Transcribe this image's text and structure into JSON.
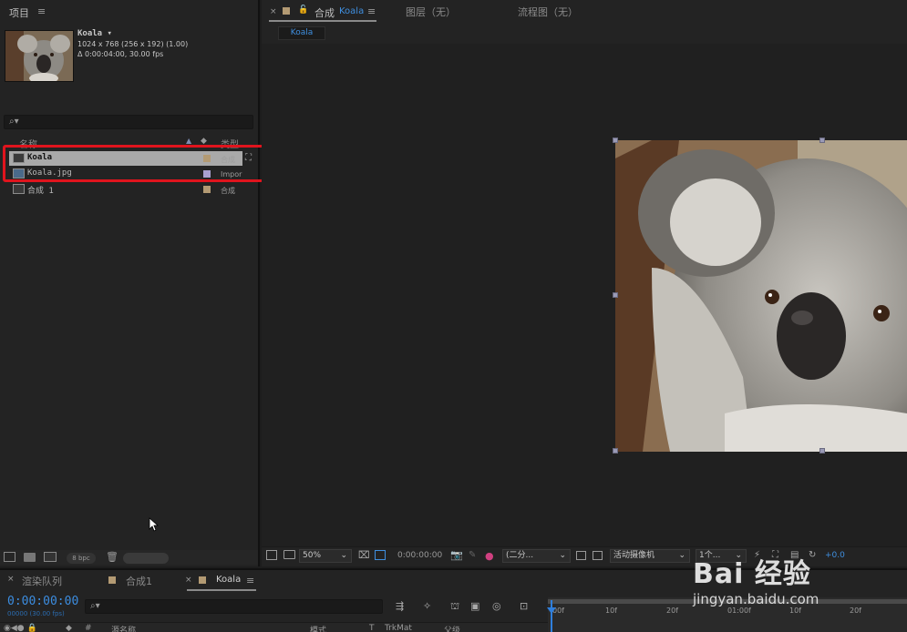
{
  "project": {
    "title": "项目",
    "menu_glyph": "≡",
    "item_name": "Koala ▾",
    "item_dims": "1024 x 768 (256 x 192) (1.00)",
    "item_duration": "Δ 0:00:04:00, 30.00 fps",
    "search_glyph": "⌕▾",
    "columns": {
      "name": "名称",
      "type": "类型"
    },
    "items": [
      {
        "name": "Koala",
        "type": "合成",
        "swatch": "#b39a73"
      },
      {
        "name": "Koala.jpg",
        "type": "Impor",
        "swatch": "#a8a0d0"
      },
      {
        "name": "合成 1",
        "type": "合成",
        "swatch": "#b39a73"
      }
    ],
    "bpc": "8 bpc"
  },
  "comp": {
    "close_glyph": "×",
    "lock_glyph": "🔓",
    "tab_prefix": "合成",
    "tab_name": "Koala",
    "layer_tab": "图层（无）",
    "flow_tab": "流程图（无）",
    "sub_tab": "Koala"
  },
  "viewer_toolbar": {
    "zoom": "50%",
    "timecode": "0:00:00:00",
    "resolution": "(二分...",
    "camera": "活动摄像机",
    "views": "1个...",
    "exposure": "+0.0"
  },
  "timeline": {
    "tabs": [
      "渲染队列",
      "合成1",
      "Koala"
    ],
    "timecode": "0:00:00:00",
    "fps_line": "00000 (30.00 fps)",
    "ruler_ticks": [
      "00f",
      "10f",
      "20f",
      "01:00f",
      "10f",
      "20f"
    ],
    "columns": {
      "num": "#",
      "source_name": "源名称",
      "mode": "模式",
      "t": "T",
      "trkmat": "TrkMat",
      "parent": "父级"
    }
  },
  "watermark": {
    "main": "Bai 经验",
    "sub": "jingyan.baidu.com"
  },
  "colors": {
    "accent_blue": "#3f8fe0",
    "highlight_red": "#e0141d",
    "comp_swatch": "#b39a73",
    "footage_swatch": "#a8a0d0"
  }
}
